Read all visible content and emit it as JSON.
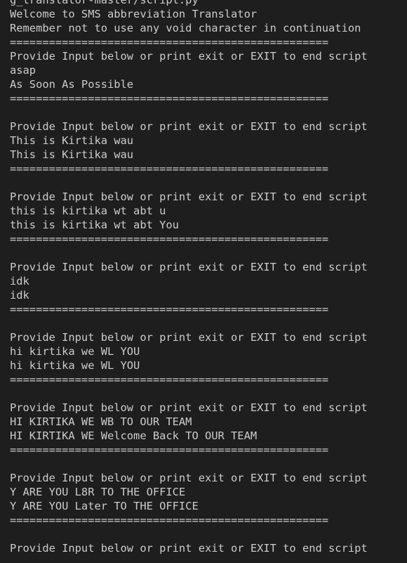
{
  "terminal": {
    "lines": [
      "g_translator-master/script.py",
      "Welcome to SMS abbreviation Translator",
      "Remember not to use any void character in continuation",
      "=================================================",
      "Provide Input below or print exit or EXIT to end script",
      "asap",
      "As Soon As Possible",
      "=================================================",
      "",
      "Provide Input below or print exit or EXIT to end script",
      "This is Kirtika wau",
      "This is Kirtika wau",
      "=================================================",
      "",
      "Provide Input below or print exit or EXIT to end script",
      "this is kirtika wt abt u",
      "this is kirtika wt abt You",
      "=================================================",
      "",
      "Provide Input below or print exit or EXIT to end script",
      "idk",
      "idk",
      "=================================================",
      "",
      "Provide Input below or print exit or EXIT to end script",
      "hi kirtika we WL YOU",
      "hi kirtika we WL YOU",
      "=================================================",
      "",
      "Provide Input below or print exit or EXIT to end script",
      "HI KIRTIKA WE WB TO OUR TEAM",
      "HI KIRTIKA WE Welcome Back TO OUR TEAM",
      "=================================================",
      "",
      "Provide Input below or print exit or EXIT to end script",
      "Y ARE YOU L8R TO THE OFFICE",
      "Y ARE YOU Later TO THE OFFICE",
      "=================================================",
      "",
      "Provide Input below or print exit or EXIT to end script"
    ]
  }
}
